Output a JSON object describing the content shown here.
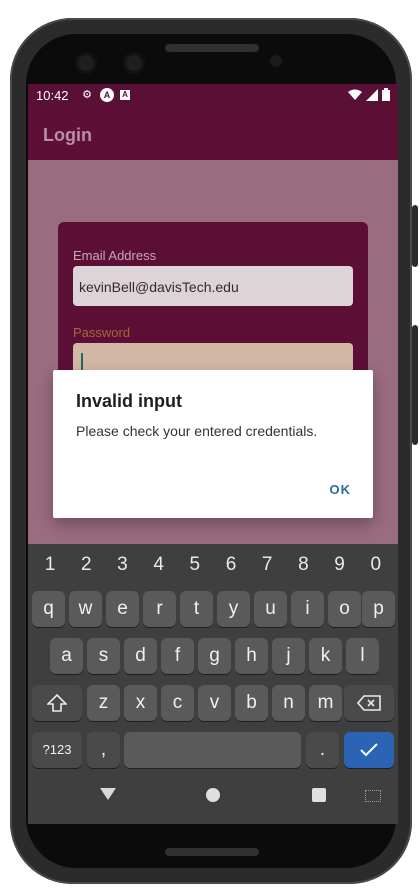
{
  "status_bar": {
    "time": "10:42"
  },
  "app_bar": {
    "title": "Login"
  },
  "form": {
    "email_label": "Email Address",
    "email_value": "kevinBell@davisTech.edu",
    "password_label": "Password"
  },
  "dialog": {
    "title": "Invalid input",
    "message": "Please check your entered credentials.",
    "ok_label": "OK"
  },
  "keyboard": {
    "numbers": [
      "1",
      "2",
      "3",
      "4",
      "5",
      "6",
      "7",
      "8",
      "9",
      "0"
    ],
    "row1": [
      "q",
      "w",
      "e",
      "r",
      "t",
      "y",
      "u",
      "i",
      "o",
      "p"
    ],
    "row2": [
      "a",
      "s",
      "d",
      "f",
      "g",
      "h",
      "j",
      "k",
      "l"
    ],
    "row3": [
      "z",
      "x",
      "c",
      "v",
      "b",
      "n",
      "m"
    ],
    "symbols_label": "?123",
    "comma_label": ",",
    "period_label": "."
  },
  "colors": {
    "app_bar": "#5e0f36",
    "scrim": "#9a6c80",
    "dialog_button": "#2a6f9a",
    "enter_key": "#2a64b3"
  }
}
